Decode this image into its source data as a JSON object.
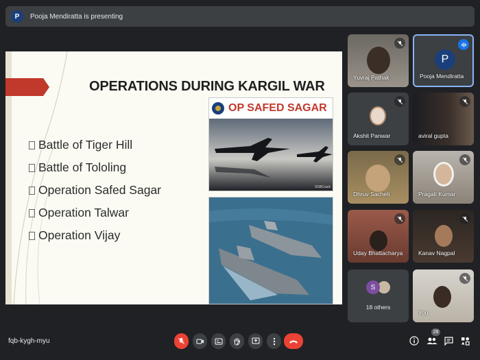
{
  "presenter_bar": {
    "avatar_letter": "P",
    "text": "Pooja Mendiratta is presenting"
  },
  "slide": {
    "title": "OPERATIONS DURING KARGIL WAR",
    "bullets": [
      "Battle of Tiger Hill",
      "Battle of Tololing",
      "Operation Safed Sagar",
      "Operation Talwar",
      "Operation Vijay"
    ],
    "image1_caption": "OP SAFED SAGAR",
    "image1_credit": "SSBCrack"
  },
  "participants": [
    {
      "name": "Yuvraj Pathak",
      "muted": true
    },
    {
      "name": "Pooja Mendiratta",
      "muted": false,
      "speaking": true,
      "avatar_letter": "P"
    },
    {
      "name": "Akshit Panwar",
      "muted": true
    },
    {
      "name": "aviral gupta",
      "muted": true
    },
    {
      "name": "Dhruv Sacheti",
      "muted": true
    },
    {
      "name": "Pragati Kumar",
      "muted": true
    },
    {
      "name": "Uday Bhattacharya",
      "muted": true
    },
    {
      "name": "Kanav Nagpal",
      "muted": true
    },
    {
      "name": "You",
      "muted": true
    }
  ],
  "others_tile": {
    "avatar_letter": "S",
    "label": "18 others"
  },
  "bottom_bar": {
    "meeting_code": "fqb-kygh-myu",
    "participant_count": "28",
    "controls": [
      "mic-off",
      "camera",
      "captions",
      "raise-hand",
      "present",
      "more",
      "end-call"
    ],
    "right_icons": [
      "info",
      "people",
      "chat",
      "activities"
    ]
  },
  "colors": {
    "background": "#202124",
    "tile": "#3c4043",
    "danger": "#ea4335",
    "accent": "#1a73e8"
  }
}
